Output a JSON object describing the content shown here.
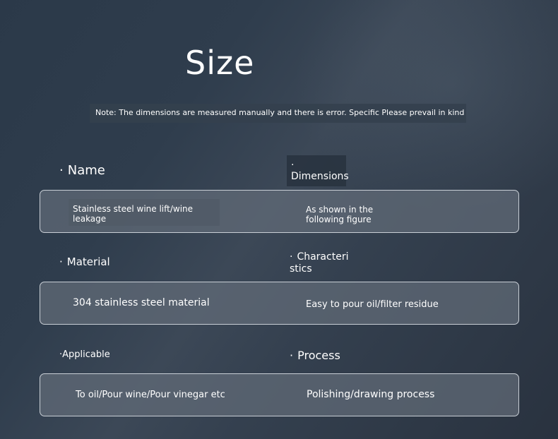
{
  "title": "Size",
  "note": "Note: The dimensions are measured manually and there is error. Specific Please prevail in kind",
  "bullet": "·",
  "labels": {
    "name": "Name",
    "dimensions": "Dimensions",
    "material": "Material",
    "characteristics": "Characteri stics",
    "applicable": "Applicable",
    "process": "Process"
  },
  "values": {
    "name": "Stainless steel wine lift/wine leakage",
    "dimensions": "As shown in the following figure",
    "material": "304 stainless steel material",
    "characteristics": "Easy to pour oil/filter residue",
    "applicable": "To oil/Pour wine/Pour vinegar etc",
    "process": "Polishing/drawing process"
  }
}
